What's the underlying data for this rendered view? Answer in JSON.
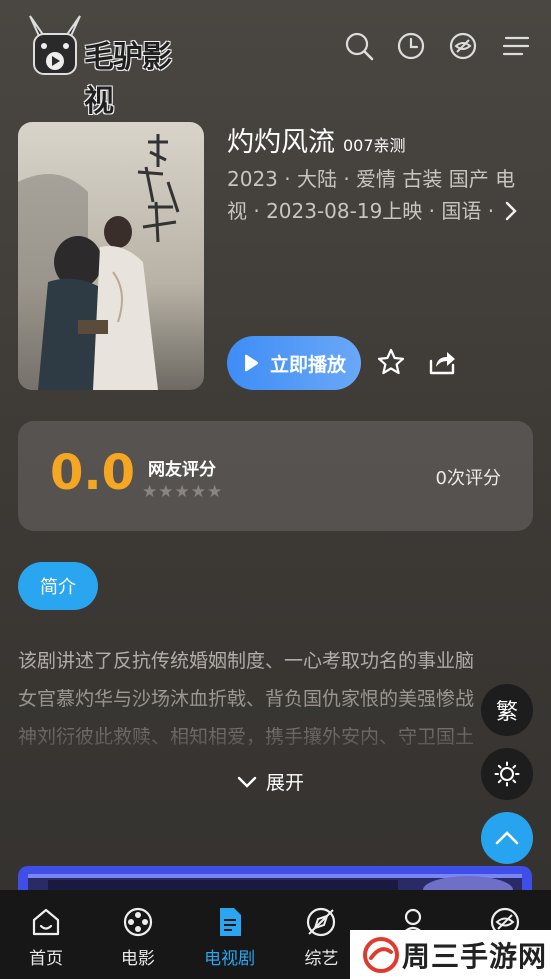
{
  "header": {
    "brand": "毛驴影视",
    "icons": [
      "search-icon",
      "history-icon",
      "eye-slash-icon",
      "menu-icon"
    ]
  },
  "movie": {
    "title": "灼灼风流",
    "tag": "007亲测",
    "meta_line1": "2023 · 大陆 · 爱情 古装 国产 电",
    "meta_line2": "视  · 2023-08-19上映 · 国语 ·",
    "play_label": "立即播放"
  },
  "rating": {
    "score": "0.0",
    "label": "网友评分",
    "stars": 0,
    "count": "0次评分",
    "score_color": "#f5a623"
  },
  "intro": {
    "tab_label": "简介",
    "lines": [
      "该剧讲述了反抗传统婚姻制度、一心考取功名的事业脑",
      "女官慕灼华与沙场沐血折戟、背负国仇家恨的美强惨战",
      "神刘衍彼此救赎、相知相爱，携手攘外安内、守卫国土"
    ],
    "expand_label": "展开"
  },
  "fabs": {
    "traditional": "繁"
  },
  "tabbar": {
    "items": [
      {
        "label": "首页",
        "icon": "home-icon"
      },
      {
        "label": "电影",
        "icon": "film-reel-icon"
      },
      {
        "label": "电视剧",
        "icon": "document-icon"
      },
      {
        "label": "综艺",
        "icon": "compass-icon"
      },
      {
        "label": "",
        "icon": "user-icon"
      },
      {
        "label": "",
        "icon": "eye-slash-icon"
      }
    ],
    "active_index": 2
  },
  "watermark": {
    "text": "周三手游网"
  },
  "colors": {
    "accent": "#2aa6f0",
    "play_button": "#4a92f6",
    "score": "#f5a623"
  }
}
